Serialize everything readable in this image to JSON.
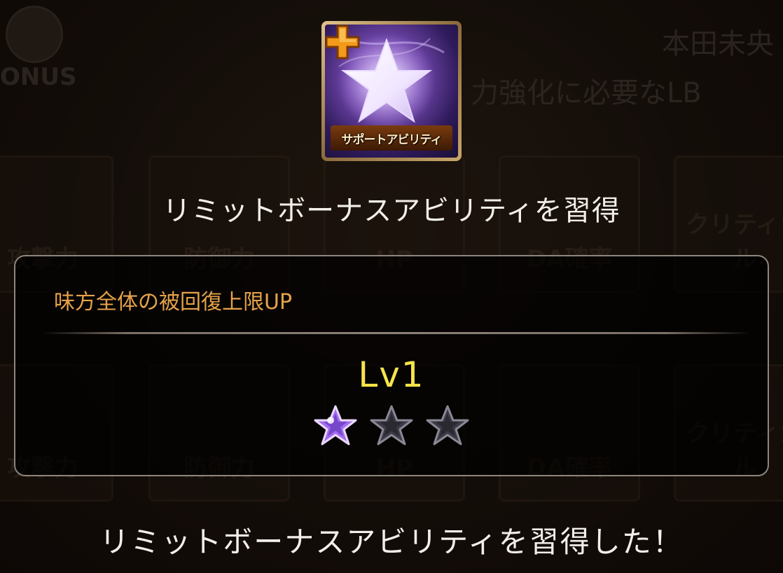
{
  "icon": {
    "name": "support-ability-icon",
    "caption": "サポートアビリティ"
  },
  "title": "リミットボーナスアビリティを習得",
  "ability": {
    "name": "味方全体の被回復上限UP",
    "level": "Lv1",
    "stars_filled": 1,
    "stars_total": 3
  },
  "message": "リミットボーナスアビリティを習得した！",
  "background": {
    "top_right_name": "本田未央",
    "top_right_text": "力強化に必要なLB",
    "bonus_label": "ONUS",
    "tile_labels": [
      "攻撃力",
      "防御力",
      "HP",
      "DA確率",
      "クリティカル"
    ]
  },
  "colors": {
    "ability_name": "#e6a24a",
    "level": "#f6e44a",
    "star_filled": "#a56cf0",
    "star_empty": "#3c3a44"
  }
}
